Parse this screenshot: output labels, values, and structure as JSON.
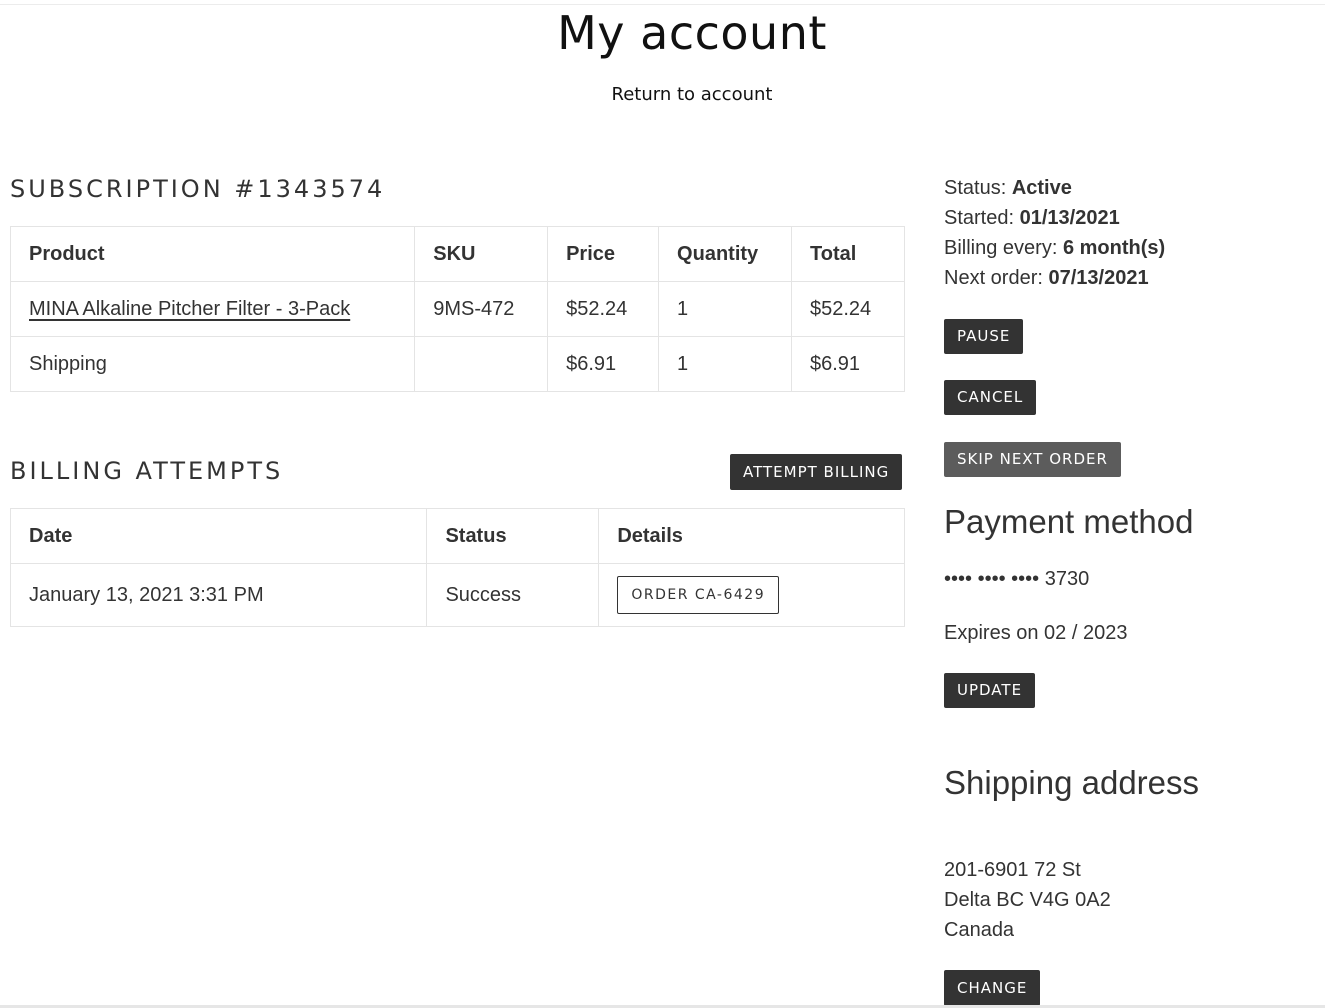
{
  "page": {
    "title": "My account",
    "return_link": "Return to account"
  },
  "subscription": {
    "heading": "SUBSCRIPTION #1343574",
    "columns": [
      "Product",
      "SKU",
      "Price",
      "Quantity",
      "Total"
    ],
    "rows": [
      {
        "product": "MINA Alkaline Pitcher Filter - 3-Pack",
        "sku": "9MS-472",
        "price": "$52.24",
        "quantity": "1",
        "total": "$52.24"
      },
      {
        "product": "Shipping",
        "sku": "",
        "price": "$6.91",
        "quantity": "1",
        "total": "$6.91"
      }
    ]
  },
  "billing": {
    "heading": "BILLING ATTEMPTS",
    "attempt_button": "ATTEMPT BILLING",
    "columns": [
      "Date",
      "Status",
      "Details"
    ],
    "rows": [
      {
        "date": "January 13, 2021 3:31 PM",
        "status": "Success",
        "details": "ORDER CA-6429"
      }
    ]
  },
  "summary": {
    "status_label": "Status:",
    "status_value": "Active",
    "started_label": "Started:",
    "started_value": "01/13/2021",
    "billing_label": "Billing every:",
    "billing_value": "6 month(s)",
    "next_label": "Next order:",
    "next_value": "07/13/2021",
    "pause_button": "PAUSE",
    "cancel_button": "CANCEL",
    "skip_button": "SKIP NEXT ORDER"
  },
  "payment": {
    "heading": "Payment method",
    "card": "•••• •••• •••• 3730",
    "expires": "Expires on 02 / 2023",
    "update_button": "UPDATE"
  },
  "shipping": {
    "heading": "Shipping address",
    "line1": "201-6901 72 St",
    "line2": "Delta BC V4G 0A2",
    "line3": "Canada",
    "change_button": "CHANGE"
  }
}
